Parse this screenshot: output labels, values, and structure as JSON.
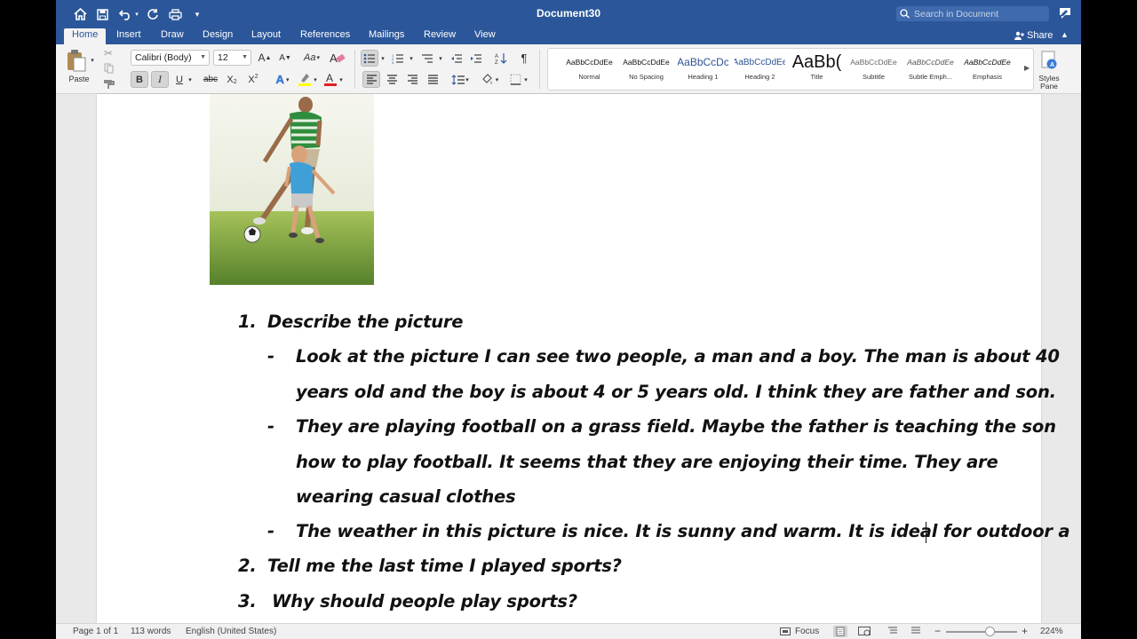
{
  "title": "Document30",
  "search": {
    "placeholder": "Search in Document"
  },
  "tabs": [
    "Home",
    "Insert",
    "Draw",
    "Design",
    "Layout",
    "References",
    "Mailings",
    "Review",
    "View"
  ],
  "active_tab": "Home",
  "share_label": "Share",
  "ribbon": {
    "paste_label": "Paste",
    "font_name": "Calibri (Body)",
    "font_size": "12",
    "bold": "B",
    "italic": "I",
    "underline": "U",
    "strike": "abc",
    "subscript": "X",
    "superscript": "X",
    "styles": [
      {
        "sample": "AaBbCcDdEe",
        "name": "Normal"
      },
      {
        "sample": "AaBbCcDdEe",
        "name": "No Spacing"
      },
      {
        "sample": "AaBbCcDc",
        "name": "Heading 1"
      },
      {
        "sample": "AaBbCcDdEe",
        "name": "Heading 2"
      },
      {
        "sample": "AaBb(",
        "name": "Title"
      },
      {
        "sample": "AaBbCcDdEe",
        "name": "Subtitle"
      },
      {
        "sample": "AaBbCcDdEe",
        "name": "Subtle Emph..."
      },
      {
        "sample": "AaBbCcDdEe",
        "name": "Emphasis"
      }
    ],
    "styles_pane_label_1": "Styles",
    "styles_pane_label_2": "Pane"
  },
  "document": {
    "items": [
      {
        "num": "1.",
        "text": "Describe the picture"
      },
      {
        "num": "2.",
        "text": "Tell me the last time I played sports?"
      },
      {
        "num": "3.",
        "text": "Why should people play sports?"
      }
    ],
    "bullets": [
      {
        "lines": [
          "Look at the picture I can see two people, a man and a boy. The man is about 40",
          "years old and the boy is about 4 or 5 years old. I think they are father and son."
        ]
      },
      {
        "lines": [
          "They are playing football on a grass field. Maybe the father is teaching the son",
          "how to play football. It seems that they are enjoying their time. They are",
          "wearing casual clothes"
        ]
      },
      {
        "lines": [
          "The weather in this picture is nice. It is sunny and warm. It is ideal for outdoor a"
        ]
      }
    ],
    "dash": "-"
  },
  "status": {
    "page": "Page 1 of 1",
    "words": "113 words",
    "language": "English (United States)",
    "focus": "Focus",
    "zoom": "224%"
  },
  "colors": {
    "title_bar": "#2b579a",
    "ribbon": "#f3f3f3",
    "highlight": "#ffff00",
    "font_color": "#e02020"
  }
}
